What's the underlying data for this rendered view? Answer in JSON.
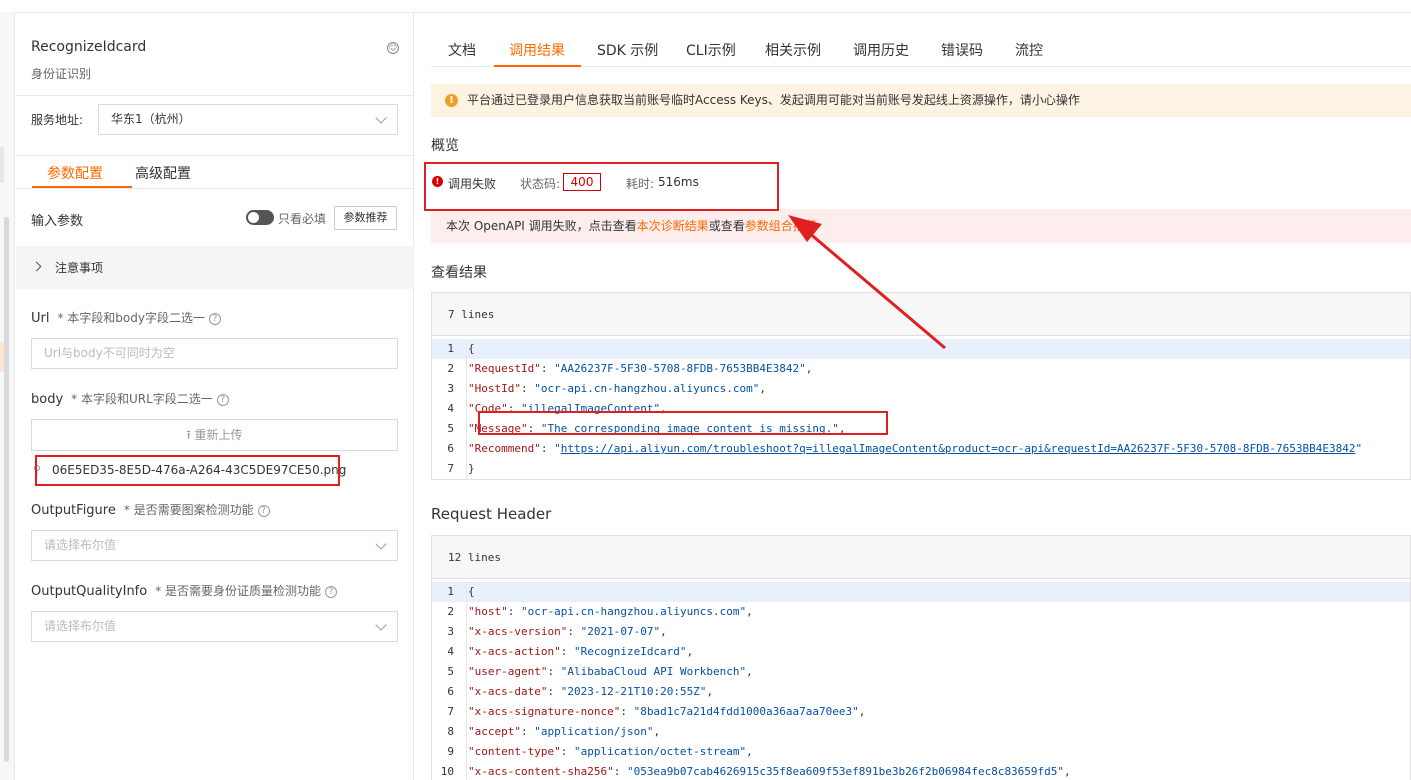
{
  "left": {
    "api_name": "RecognizeIdcard",
    "api_desc": "身份证识别",
    "service_label": "服务地址:",
    "service_value": "华东1（杭州）",
    "tabs": [
      "参数配置",
      "高级配置"
    ],
    "input_params_label": "输入参数",
    "required_only_label": "只看必填",
    "recommend_button": "参数推荐",
    "notice_label": "注意事项",
    "params": [
      {
        "name": "Url",
        "note": "* 本字段和body字段二选一",
        "placeholder": "Url与body不可同时为空"
      },
      {
        "name": "body",
        "note": "* 本字段和URL字段二选一",
        "upload_label": "重新上传",
        "file_name": "06E5ED35-8E5D-476a-A264-43C5DE97CE50.png"
      },
      {
        "name": "OutputFigure",
        "note": "* 是否需要图案检测功能",
        "placeholder": "请选择布尔值"
      },
      {
        "name": "OutputQualityInfo",
        "note": "* 是否需要身份证质量检测功能",
        "placeholder": "请选择布尔值"
      }
    ]
  },
  "right": {
    "tabs": [
      "文档",
      "调用结果",
      "SDK 示例",
      "CLI示例",
      "相关示例",
      "调用历史",
      "错误码",
      "流控"
    ],
    "warning": "平台通过已登录用户信息获取当前账号临时Access Keys、发起调用可能对当前账号发起线上资源操作，请小心操作",
    "overview_title": "概览",
    "status_text": "调用失败",
    "status_code_label": "状态码:",
    "status_code": "400",
    "time_label": "耗时:",
    "time_value": "516ms",
    "fail_msg_prefix": "本次 OpenAPI 调用失败，点击查看",
    "fail_link1": "本次诊断结果",
    "fail_msg_mid": "或查看",
    "fail_link2": "参数组合推荐",
    "view_result_title": "查看结果",
    "result_lines_label": "7 lines",
    "request_header_title": "Request Header",
    "header_lines_label": "12 lines"
  },
  "result_lines": [
    {
      "n": "1",
      "open": "{"
    },
    {
      "n": "2",
      "key": "\"RequestId\"",
      "val": "\"AA26237F-5F30-5708-8FDB-7653BB4E3842\"",
      "tail": ","
    },
    {
      "n": "3",
      "key": "\"HostId\"",
      "val": "\"ocr-api.cn-hangzhou.aliyuncs.com\"",
      "tail": ","
    },
    {
      "n": "4",
      "key": "\"Code\"",
      "val": "\"illegalImageContent\"",
      "tail": ","
    },
    {
      "n": "5",
      "key": "\"Message\"",
      "val": "\"The corresponding image content is missing.\"",
      "tail": ","
    },
    {
      "n": "6",
      "key": "\"Recommend\"",
      "pre": "\"",
      "url": "https://api.aliyun.com/troubleshoot?q=illegalImageContent&product=ocr-api&requestId=AA26237F-5F30-5708-8FDB-7653BB4E3842",
      "post": "\""
    },
    {
      "n": "7",
      "open": "}"
    }
  ],
  "header_lines": [
    {
      "n": "1",
      "open": "{"
    },
    {
      "n": "2",
      "key": "\"host\"",
      "val": "\"ocr-api.cn-hangzhou.aliyuncs.com\"",
      "tail": ","
    },
    {
      "n": "3",
      "key": "\"x-acs-version\"",
      "val": "\"2021-07-07\"",
      "tail": ","
    },
    {
      "n": "4",
      "key": "\"x-acs-action\"",
      "val": "\"RecognizeIdcard\"",
      "tail": ","
    },
    {
      "n": "5",
      "key": "\"user-agent\"",
      "val": "\"AlibabaCloud API Workbench\"",
      "tail": ","
    },
    {
      "n": "6",
      "key": "\"x-acs-date\"",
      "val": "\"2023-12-21T10:20:55Z\"",
      "tail": ","
    },
    {
      "n": "7",
      "key": "\"x-acs-signature-nonce\"",
      "val": "\"8bad1c7a21d4fdd1000a36aa7aa70ee3\"",
      "tail": ","
    },
    {
      "n": "8",
      "key": "\"accept\"",
      "val": "\"application/json\"",
      "tail": ","
    },
    {
      "n": "9",
      "key": "\"content-type\"",
      "val": "\"application/octet-stream\"",
      "tail": ","
    },
    {
      "n": "10",
      "key": "\"x-acs-content-sha256\"",
      "val": "\"053ea9b07cab4626915c35f8ea609f53ef891be3b26f2b06984fec8c83659fd5\"",
      "tail": ","
    }
  ],
  "colors": {
    "accent": "#ff6a00",
    "error": "#e02020",
    "warning_bg": "#fdf3e2",
    "error_bg": "#fdeeed"
  }
}
